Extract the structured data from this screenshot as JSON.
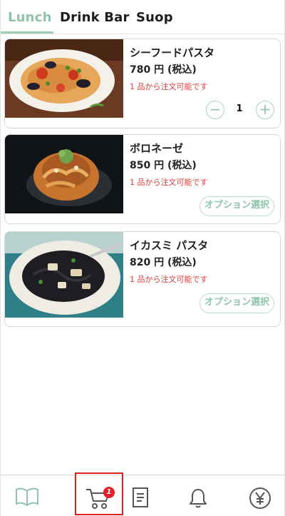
{
  "tabs": [
    {
      "label": "Lunch",
      "active": true
    },
    {
      "label": "Drink Bar",
      "active": false
    },
    {
      "label": "Suop",
      "active": false
    }
  ],
  "menu_items": [
    {
      "name": "シーフードパスタ",
      "price": "780 円 (税込)",
      "note": "1 品から注文可能です",
      "action": "stepper",
      "quantity": "1",
      "image": "seafood-pasta-photo"
    },
    {
      "name": "ボロネーゼ",
      "price": "850 円 (税込)",
      "note": "1 品から注文可能です",
      "action": "option",
      "option_label": "オプション選択",
      "image": "bolognese-photo"
    },
    {
      "name": "イカスミ パスタ",
      "price": "820 円 (税込)",
      "note": "1 品から注文可能です",
      "action": "option",
      "option_label": "オプション選択",
      "image": "squid-ink-pasta-photo"
    }
  ],
  "stepper": {
    "minus": "−",
    "plus": "+"
  },
  "bottom_nav": {
    "items": [
      "menu-book-icon",
      "cart-icon",
      "receipt-icon",
      "bell-icon",
      "yen-icon"
    ],
    "cart_badge": "1"
  },
  "colors": {
    "accent": "#8fc4aa",
    "note_red": "#e33b3b",
    "badge_red": "#e3202a",
    "highlight_red": "#e0201f"
  }
}
